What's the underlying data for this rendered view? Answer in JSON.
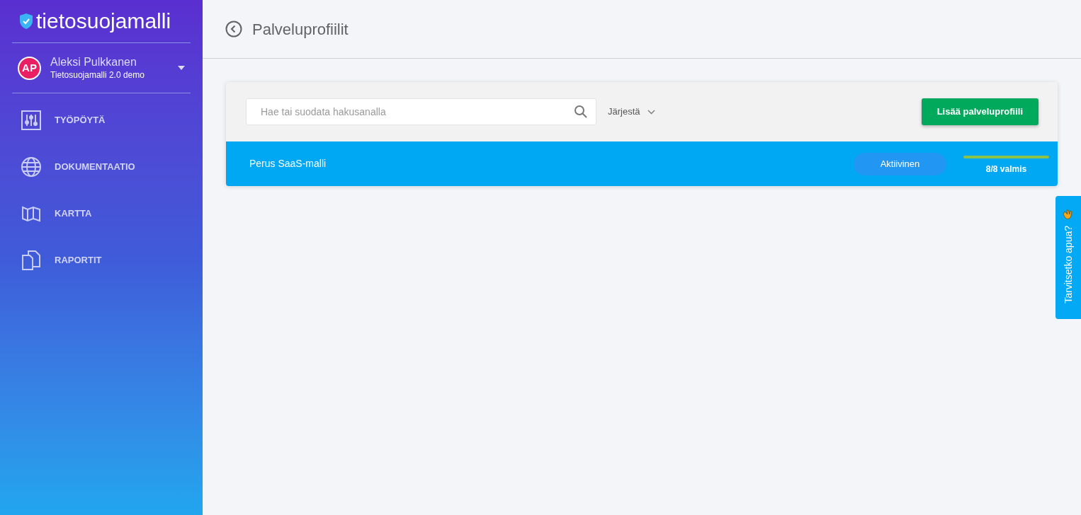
{
  "brand": {
    "name": "tietosuojamalli"
  },
  "user": {
    "initials": "AP",
    "name": "Aleksi Pulkkanen",
    "organization": "Tietosuojamalli 2.0 demo"
  },
  "nav": [
    {
      "kind": "dashboard",
      "label": "TYÖPÖYTÄ"
    },
    {
      "kind": "globe",
      "label": "DOKUMENTAATIO"
    },
    {
      "kind": "map",
      "label": "KARTTA"
    },
    {
      "kind": "reports",
      "label": "RAPORTIT"
    }
  ],
  "header": {
    "title": "Palveluprofiilit"
  },
  "toolbar": {
    "search_placeholder": "Hae tai suodata hakusanalla",
    "sort_label": "Järjestä",
    "add_button": "Lisää palveluprofiili"
  },
  "profiles": [
    {
      "name": "Perus SaaS-malli",
      "status": "Aktiivinen",
      "level": 1,
      "progress": "8/8 valmis"
    }
  ],
  "help_tab": {
    "label": "Tarvitsetko apua?"
  }
}
